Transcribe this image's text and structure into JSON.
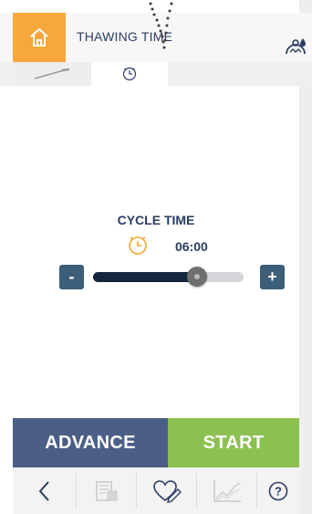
{
  "header": {
    "title": "THAWING TIME",
    "home_icon": "home-icon",
    "right_icon": "person-drop-icon"
  },
  "tabs": [
    {
      "icon": "probe-icon",
      "active": false
    },
    {
      "icon": "clock-icon",
      "active": true
    }
  ],
  "main": {
    "cycle_title": "CYCLE TIME",
    "time_value": "06:00",
    "minus_label": "-",
    "plus_label": "+",
    "slider_level": 0.69,
    "clock_color": "#f0a530"
  },
  "actions": {
    "advance_label": "ADVANCE",
    "start_label": "START",
    "advance_color": "#4b5e86",
    "start_color": "#8cc152"
  },
  "toolbar": {
    "items": [
      {
        "icon": "back-icon"
      },
      {
        "icon": "recipe-book-icon"
      },
      {
        "icon": "favorite-edit-icon"
      },
      {
        "icon": "chart-icon"
      },
      {
        "icon": "help-icon",
        "label": "?"
      }
    ]
  },
  "colors": {
    "accent": "#f7a83c",
    "text": "#2a3c62"
  }
}
